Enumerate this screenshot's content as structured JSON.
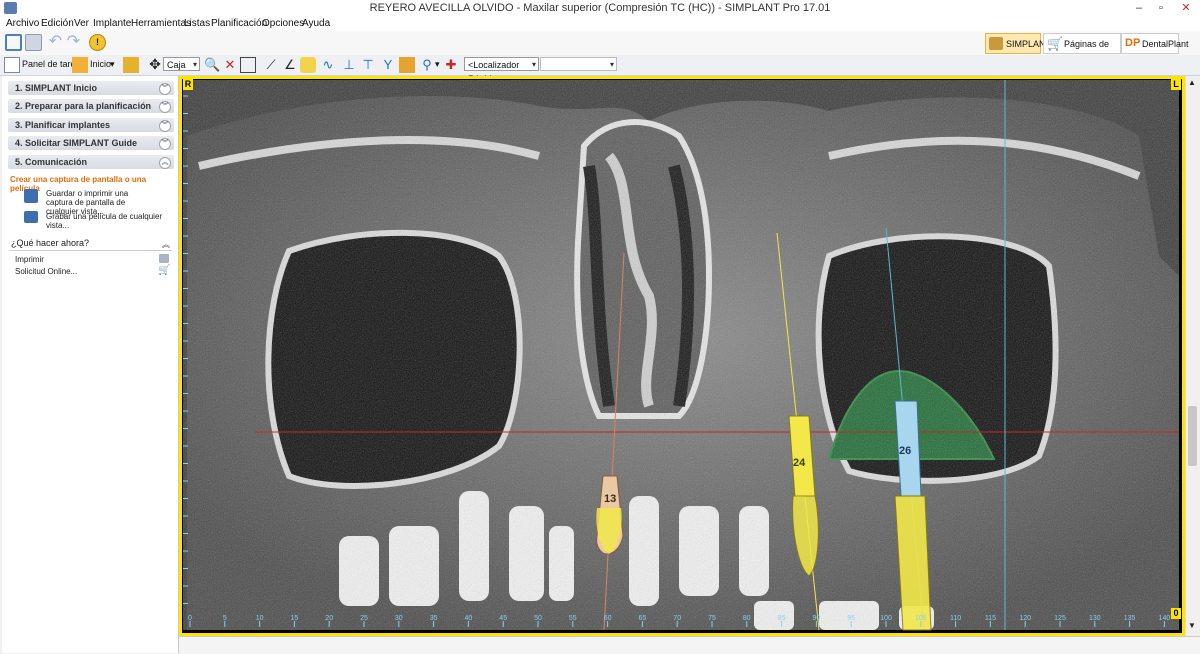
{
  "window": {
    "title": "REYERO AVECILLA OLVIDO - Maxilar superior (Compresión TC (HC)) - SIMPLANT Pro 17.01",
    "minimize": "–",
    "maximize": "▫",
    "close": "✕"
  },
  "menu": [
    "Archivo",
    "Edición",
    "Ver",
    "Implante",
    "Herramientas",
    "Listas",
    "Planificación",
    "Opciones",
    "Ayuda"
  ],
  "toolbar_right": {
    "simplant": "SIMPLANT",
    "pedidos": "Páginas de Pedidos",
    "dentalplant": "DentalPlant"
  },
  "toolbar2": {
    "panel_label": "Panel de tareas",
    "inicio_label": "Inicio",
    "caja_value": "Caja",
    "localizador_value": "<Localizador Rápido"
  },
  "taskpane": {
    "sections": [
      {
        "label": "1. SIMPLANT Inicio"
      },
      {
        "label": "2. Preparar para la planificación"
      },
      {
        "label": "3. Planificar implantes"
      },
      {
        "label": "4. Solicitar SIMPLANT Guide"
      },
      {
        "label": "5. Comunicación"
      }
    ],
    "capture_heading": "Crear una captura de pantalla o una película",
    "capture_item1": "Guardar o imprimir una captura de pantalla de cualquier vista...",
    "capture_item2": "Grabar una película de cualquier vista...",
    "next_heading": "¿Qué hacer ahora?",
    "next_items": [
      {
        "label": "Imprimir"
      },
      {
        "label": "Solicitud Online..."
      }
    ]
  },
  "viewer": {
    "corner_left": "R",
    "corner_right": "L",
    "corner_bottom_right": "0",
    "implants": [
      {
        "label": "13",
        "color": "#e9c9a4"
      },
      {
        "label": "24",
        "color": "#f2e84a"
      },
      {
        "label": "26",
        "color": "#a9d6ef"
      }
    ],
    "ruler_ticks": [
      "0",
      "5",
      "10",
      "15",
      "20",
      "25",
      "30",
      "35",
      "40",
      "45",
      "50",
      "55",
      "60",
      "65",
      "70",
      "75",
      "80",
      "85",
      "90",
      "95",
      "100",
      "105",
      "110",
      "115",
      "120",
      "125",
      "130",
      "135",
      "140"
    ]
  },
  "colors": {
    "viewer_frame": "#ffe400",
    "graft": "#1f6b34",
    "crosshair_red": "#c0282d",
    "crosshair_blue": "#5fb7d6",
    "orange_heading": "#e46c0a"
  }
}
